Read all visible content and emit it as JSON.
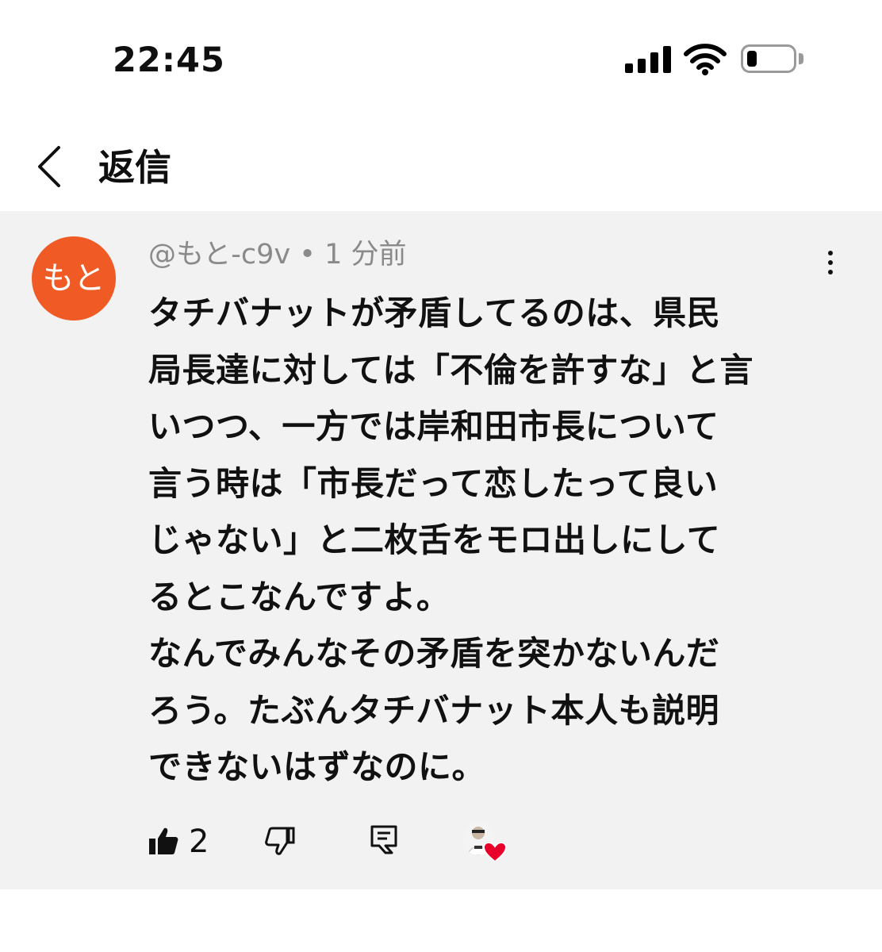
{
  "status_bar": {
    "time": "22:45",
    "battery_level": 0.2
  },
  "header": {
    "title": "返信",
    "back_icon": "chevron-left-icon"
  },
  "comment": {
    "avatar_text": "もと",
    "avatar_color": "#f05a24",
    "author": "@もと-c9v",
    "separator": " • ",
    "timestamp": "1 分前",
    "body": "タチバナットが矛盾してるのは、県民\n局長達に対しては「不倫を許すな」と言\nいつつ、一方では岸和田市長について\n言う時は「市長だって恋したって良い\nじゃない」と二枚舌をモロ出しにして\nるとこなんですよ。\nなんでみんなその矛盾を突かないんだ\nろう。たぶんタチバナット本人も説明\nできないはずなのに。",
    "more_icon": "more-vertical-icon"
  },
  "actions": {
    "like_icon": "thumbs-up-icon",
    "like_count": "2",
    "dislike_icon": "thumbs-down-icon",
    "reply_icon": "reply-icon",
    "creator_heart_icon": "creator-heart-icon",
    "heart_color": "#e8002a"
  }
}
